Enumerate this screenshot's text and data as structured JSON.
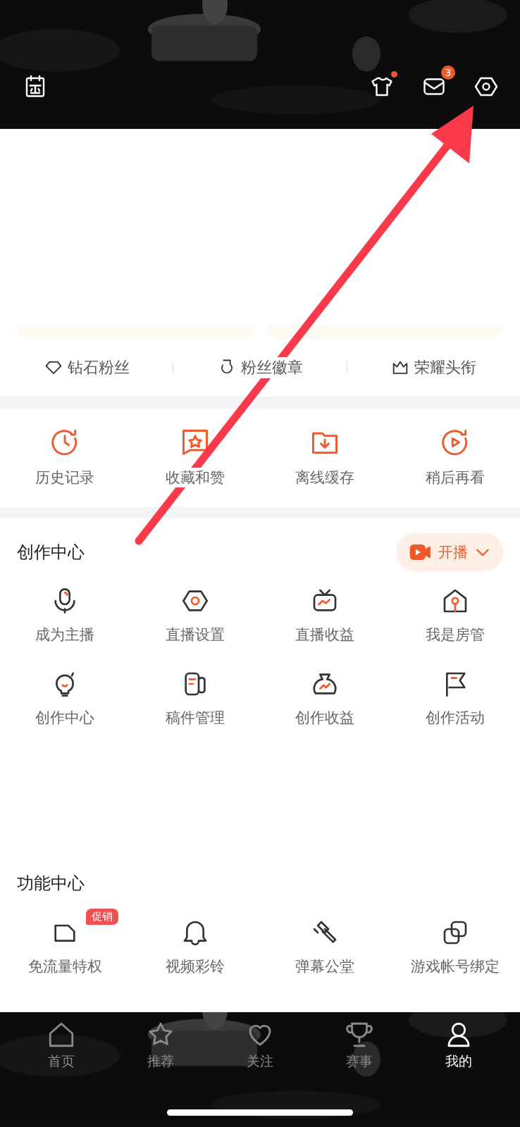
{
  "header": {
    "actions": [
      {
        "kind": "dot"
      },
      {
        "kind": "count",
        "badge": "3"
      },
      {
        "kind": "plain"
      }
    ]
  },
  "fan_links": [
    "钻石粉丝",
    "粉丝徽章",
    "荣耀头衔"
  ],
  "shortcuts": [
    "历史记录",
    "收藏和赞",
    "离线缓存",
    "稍后再看"
  ],
  "creator_center": {
    "title": "创作中心",
    "live_button": "开播",
    "items": [
      "成为主播",
      "直播设置",
      "直播收益",
      "我是房管",
      "创作中心",
      "稿件管理",
      "创作收益",
      "创作活动"
    ]
  },
  "function_center": {
    "title": "功能中心",
    "items": [
      {
        "label": "免流量特权",
        "badge": "促销"
      },
      {
        "label": "视频彩铃"
      },
      {
        "label": "弹幕公堂"
      },
      {
        "label": "游戏帐号绑定"
      }
    ]
  },
  "nav": [
    {
      "label": "首页",
      "selected": false
    },
    {
      "label": "推荐",
      "selected": false
    },
    {
      "label": "关注",
      "selected": false
    },
    {
      "label": "赛事",
      "selected": false
    },
    {
      "label": "我的",
      "selected": true
    }
  ]
}
